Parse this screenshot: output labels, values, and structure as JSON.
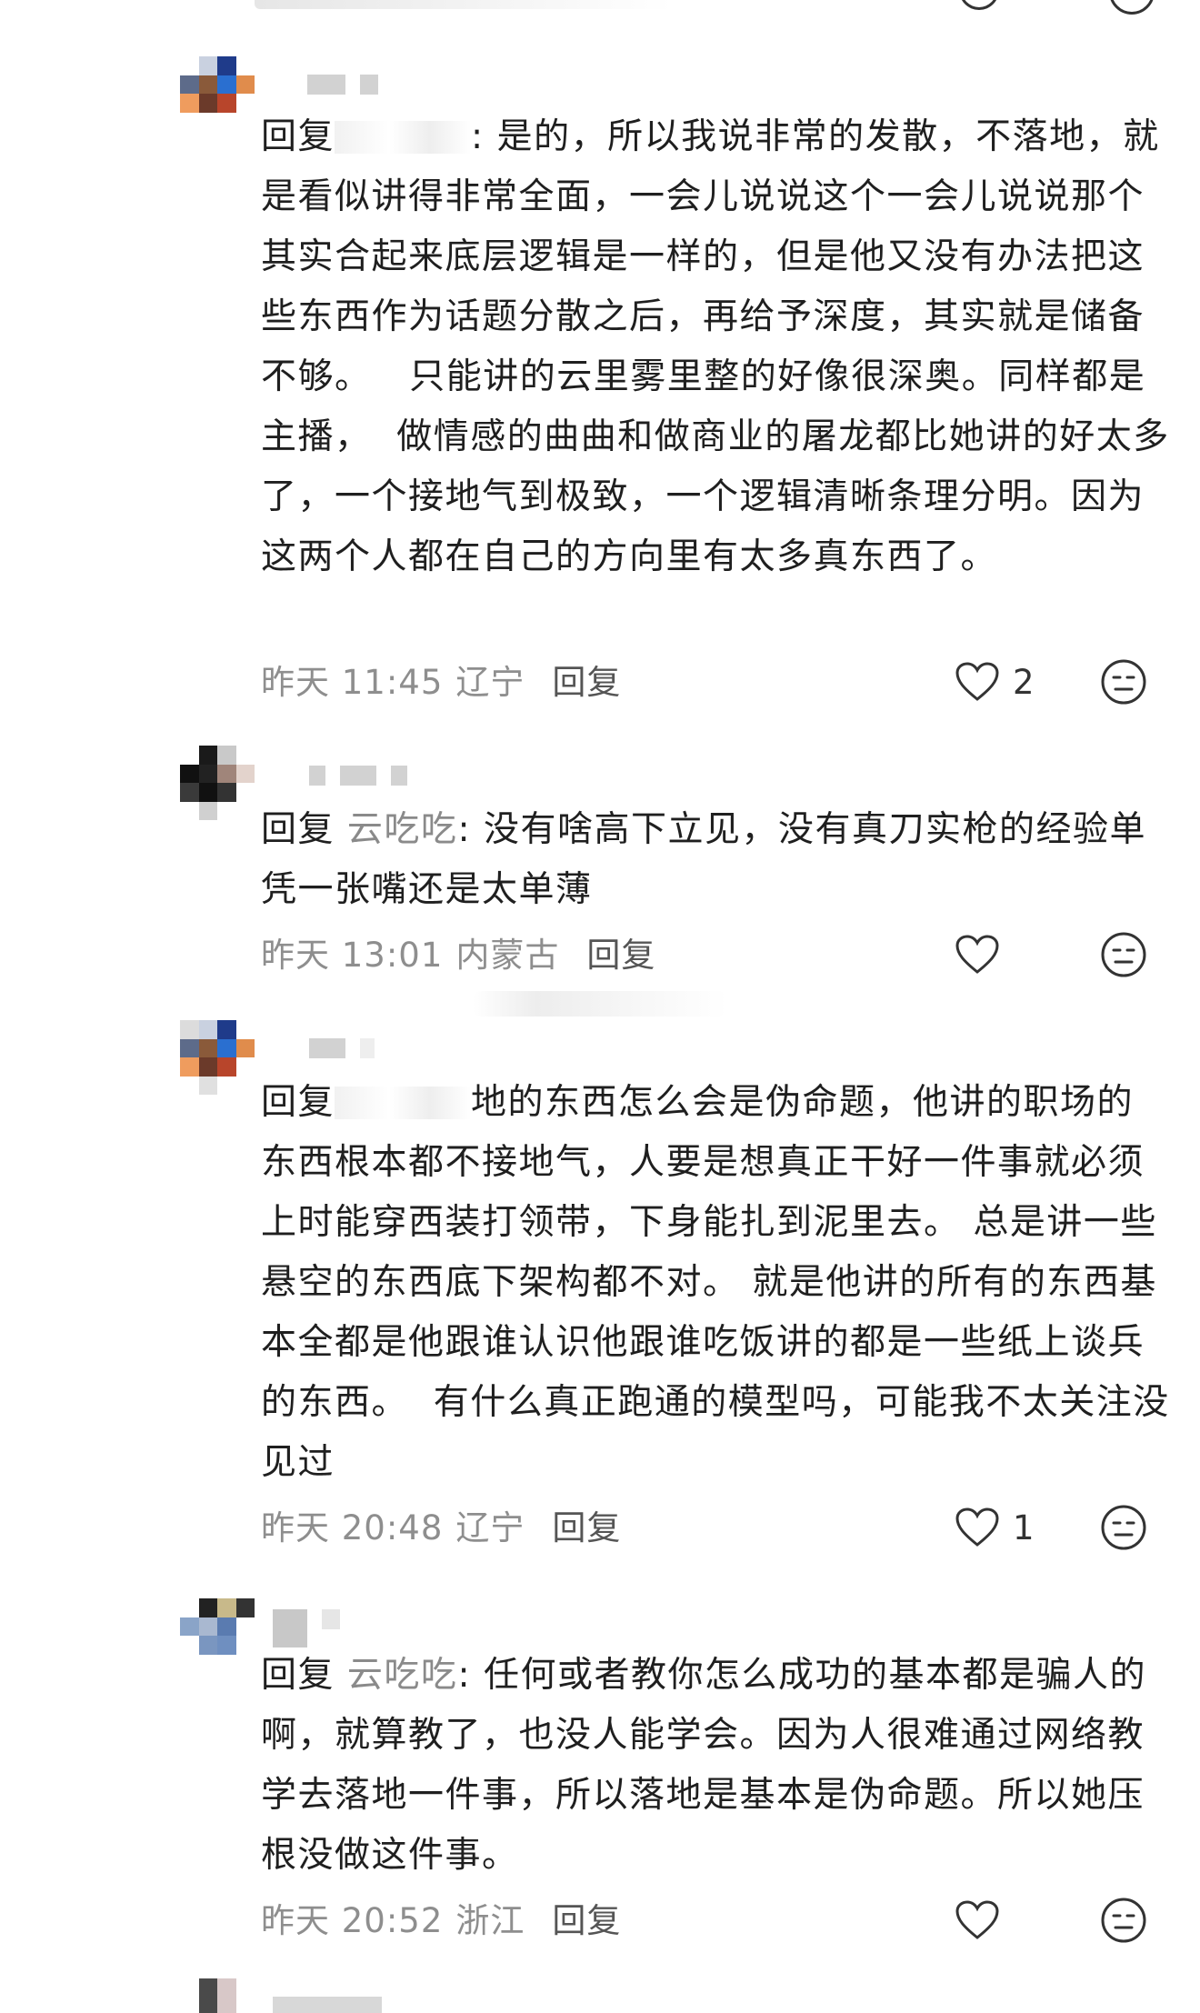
{
  "comments": [
    {
      "reply_prefix": "回复",
      "mention": "",
      "text": "是的，所以我说非常的发散，不落地，就是看似讲得非常全面，一会儿说说这个一会儿说说那个其实合起来底层逻辑是一样的，但是他又没有办法把这些东西作为话题分散之后，再给予深度，其实就是储备不够。   只能讲的云里雾里整的好像很深奥。同样都是主播，  做情感的曲曲和做商业的屠龙都比她讲的好太多了，一个接地气到极致，一个逻辑清晰条理分明。因为这两个人都在自己的方向里有太多真东西了。",
      "time": "昨天 11:45",
      "location": "辽宁",
      "reply_label": "回复",
      "likes": "2"
    },
    {
      "reply_prefix": "回复",
      "mention": "云吃吃",
      "text": "没有啥高下立见，没有真刀实枪的经验单凭一张嘴还是太单薄",
      "time": "昨天 13:01",
      "location": "内蒙古",
      "reply_label": "回复",
      "likes": ""
    },
    {
      "reply_prefix": "回复",
      "mention": "",
      "text": "地的东西怎么会是伪命题，他讲的职场的东西根本都不接地气，人要是想真正干好一件事就必须上时能穿西装打领带，下身能扎到泥里去。 总是讲一些悬空的东西底下架构都不对。 就是他讲的所有的东西基本全都是他跟谁认识他跟谁吃饭讲的都是一些纸上谈兵的东西。  有什么真正跑通的模型吗，可能我不太关注没见过",
      "time": "昨天 20:48",
      "location": "辽宁",
      "reply_label": "回复",
      "likes": "1"
    },
    {
      "reply_prefix": "回复",
      "mention": "云吃吃",
      "text": "任何或者教你怎么成功的基本都是骗人的啊，就算教了，也没人能学会。因为人很难通过网络教学去落地一件事，所以落地是基本是伪命题。所以她压根没做这件事。",
      "time": "昨天 20:52",
      "location": "浙江",
      "reply_label": "回复",
      "likes": ""
    }
  ],
  "icons": {
    "like": "heart-outline-icon",
    "emoji": "neutral-face-icon"
  },
  "colors": {
    "text": "#1f1f1f",
    "meta": "#8e8e8e",
    "mention": "#8a8a8a",
    "icon": "#333333"
  }
}
